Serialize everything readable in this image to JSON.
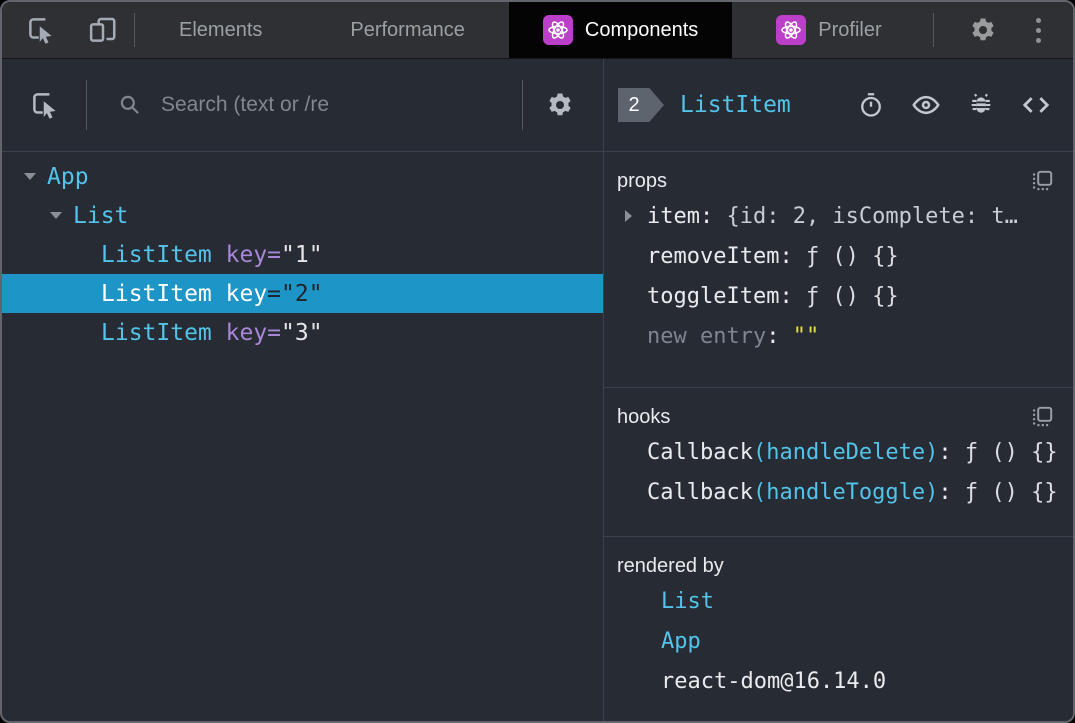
{
  "tabbar": {
    "tabs": [
      {
        "label": "Elements",
        "active": false
      },
      {
        "label": "Performance",
        "active": false
      },
      {
        "label": "Components",
        "active": true
      },
      {
        "label": "Profiler",
        "active": false
      }
    ]
  },
  "left_panel": {
    "search": {
      "placeholder": "Search (text or /re"
    },
    "tree": {
      "nodes": [
        {
          "name": "App",
          "depth": 0,
          "expanded": true,
          "selected": false
        },
        {
          "name": "List",
          "depth": 1,
          "expanded": true,
          "selected": false
        },
        {
          "name": "ListItem",
          "attr_name": "key",
          "equals": "=",
          "attr_value": "\"1\"",
          "depth": 2,
          "selected": false
        },
        {
          "name": "ListItem",
          "attr_name": "key",
          "equals": "=",
          "attr_value": "\"2\"",
          "depth": 2,
          "selected": true
        },
        {
          "name": "ListItem",
          "attr_name": "key",
          "equals": "=",
          "attr_value": "\"3\"",
          "depth": 2,
          "selected": false
        }
      ]
    }
  },
  "right_panel": {
    "header": {
      "badge": "2",
      "component_name": "ListItem"
    },
    "props": {
      "title": "props",
      "rows": [
        {
          "key": "item",
          "value": "{id: 2, isComplete: t…",
          "expandable": true
        },
        {
          "key": "removeItem",
          "value": "ƒ () {}"
        },
        {
          "key": "toggleItem",
          "value": "ƒ () {}"
        },
        {
          "key": "new entry",
          "value": "\"\""
        }
      ]
    },
    "hooks": {
      "title": "hooks",
      "rows": [
        {
          "hook_type": "Callback",
          "hook_name": "(handleDelete)",
          "value": "ƒ () {}"
        },
        {
          "hook_type": "Callback",
          "hook_name": "(handleToggle)",
          "value": "ƒ () {}"
        }
      ]
    },
    "rendered_by": {
      "title": "rendered by",
      "items": [
        {
          "label": "List",
          "link": true
        },
        {
          "label": "App",
          "link": true
        },
        {
          "label": "react-dom@16.14.0",
          "link": false
        }
      ]
    }
  },
  "punctuation": {
    "colon": ":"
  },
  "icons": {
    "inspect": "cursor-in-square",
    "device_toolbar": "overlapping-rectangles",
    "react_logo": "atom-on-purple-square",
    "settings": "gear",
    "menu": "kebab-three-dots",
    "search": "magnifier",
    "suspense": "stopwatch",
    "inspect_dom": "eye",
    "log_to_console": "bug",
    "view_source": "angle-brackets",
    "copy": "square-with-dots"
  },
  "colors": {
    "panel_background": "#272b33",
    "topbar_background": "#2f3034",
    "selected_row": "#1e95c7",
    "component_cyan": "#53c3ea",
    "attribute_purple": "#a886d8",
    "string_yellow": "#e5e13b",
    "react_icon_purple": "#bb3fc8"
  }
}
